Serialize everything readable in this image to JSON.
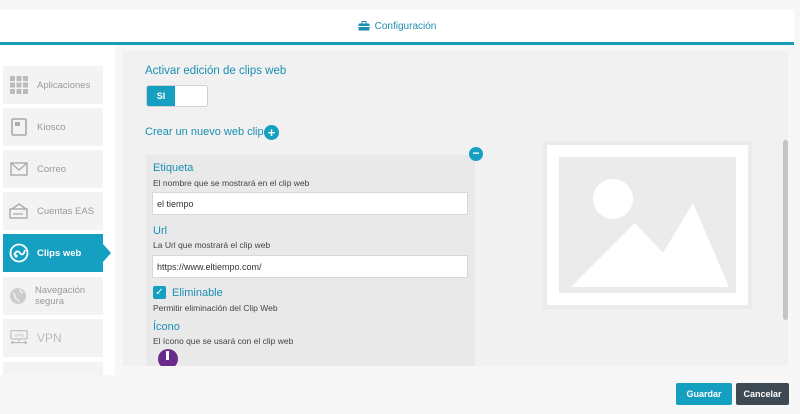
{
  "header": {
    "title": "Configuración",
    "icon": "briefcase-icon"
  },
  "sidebar": {
    "items": [
      {
        "label": "Aplicaciones",
        "icon": "grid-icon",
        "active": false
      },
      {
        "label": "Kiosco",
        "icon": "kiosk-icon",
        "active": false
      },
      {
        "label": "Correo",
        "icon": "envelope-icon",
        "active": false
      },
      {
        "label": "Cuentas EAS",
        "icon": "eas-account-icon",
        "active": false
      },
      {
        "label": "Clips web",
        "icon": "webclip-icon",
        "active": true
      },
      {
        "label": "Navegación segura",
        "icon": "globe-icon",
        "active": false
      },
      {
        "label": "VPN",
        "icon": "vpn-icon",
        "active": false
      }
    ]
  },
  "main": {
    "enable_label": "Activar edición de clips web",
    "toggle_value": "SI",
    "create_label": "Crear un nuevo web clip",
    "form": {
      "tag_title": "Etiqueta",
      "tag_help": "El nombre que se mostrará en el clip web",
      "tag_value": "el tiempo",
      "url_title": "Url",
      "url_help": "La Url que mostrará el clip web",
      "url_value": "https://www.eltiempo.com/",
      "removable_label": "Eliminable",
      "removable_checked": true,
      "removable_help": "Permitir eliminación del Clip Web",
      "icon_title": "Ícono",
      "icon_help": "El ícono que se usará con el clip web"
    }
  },
  "footer": {
    "save_label": "Guardar",
    "cancel_label": "Cancelar"
  },
  "colors": {
    "accent": "#159fc0",
    "dark_button": "#3d4a53",
    "label": "#1a8fb3"
  }
}
